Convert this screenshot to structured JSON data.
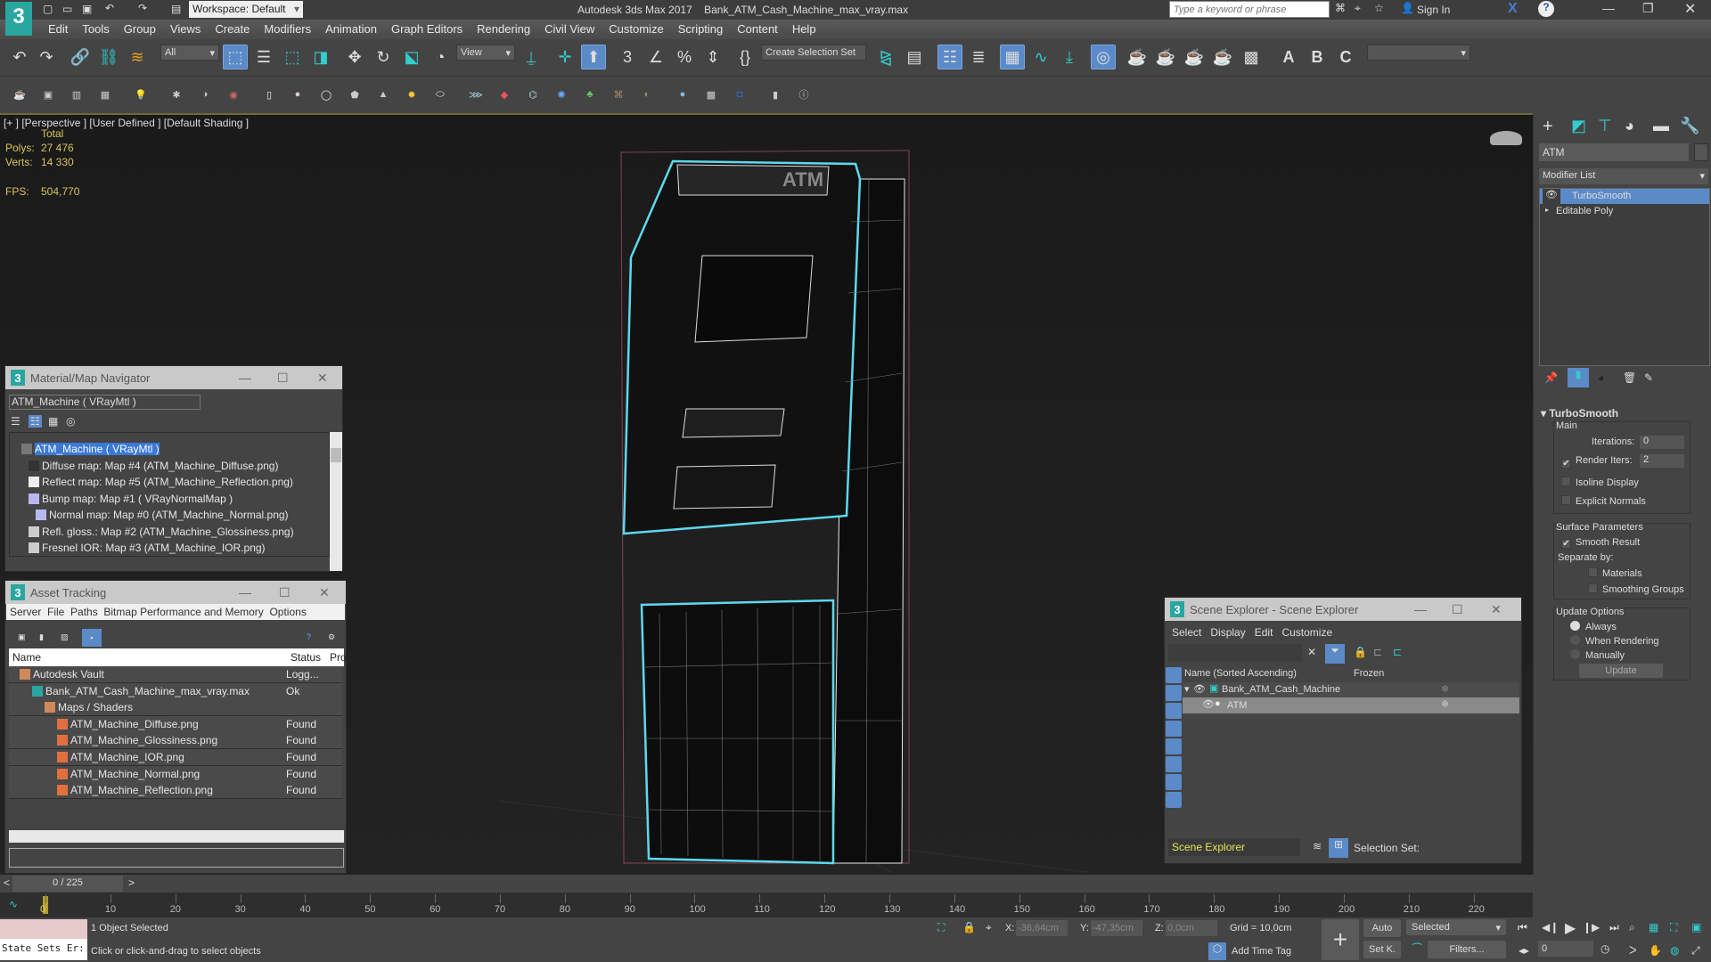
{
  "app": {
    "title": "Autodesk 3ds Max 2017",
    "file": "Bank_ATM_Cash_Machine_max_vray.max",
    "workspace": "Workspace: Default",
    "search_placeholder": "Type a keyword or phrase",
    "sign_in": "Sign In"
  },
  "menu": [
    "Edit",
    "Tools",
    "Group",
    "Views",
    "Create",
    "Modifiers",
    "Animation",
    "Graph Editors",
    "Rendering",
    "Civil View",
    "Customize",
    "Scripting",
    "Content",
    "Help"
  ],
  "toolbar": {
    "selection_filter": "All",
    "ref_coord": "View",
    "create_selection_set": "Create Selection Set"
  },
  "viewport": {
    "label": "[+ ]  [Perspective ]  [User Defined ]  [Default Shading ]",
    "stats_header": "Total",
    "polys_label": "Polys:",
    "polys": "27 476",
    "verts_label": "Verts:",
    "verts": "14 330",
    "fps_label": "FPS:",
    "fps": "504,770",
    "model_sign": "ATM"
  },
  "command_panel": {
    "object_name": "ATM",
    "modifier_list": "Modifier List",
    "stack": [
      {
        "label": "TurboSmooth",
        "selected": true
      },
      {
        "label": "Editable Poly",
        "selected": false
      }
    ],
    "rollout_title": "TurboSmooth",
    "main_group": "Main",
    "iterations_label": "Iterations:",
    "iterations": "0",
    "render_iters_label": "Render Iters:",
    "render_iters": "2",
    "isoline": "Isoline Display",
    "explicit_normals": "Explicit Normals",
    "surface_group": "Surface Parameters",
    "smooth_result": "Smooth Result",
    "separate_by": "Separate by:",
    "materials": "Materials",
    "smoothing_groups": "Smoothing Groups",
    "update_group": "Update Options",
    "always": "Always",
    "when_rendering": "When Rendering",
    "manually": "Manually",
    "update_btn": "Update"
  },
  "mat_nav": {
    "title": "Material/Map Navigator",
    "field": "ATM_Machine  ( VRayMtl )",
    "items": [
      "ATM_Machine  ( VRayMtl )",
      "Diffuse map: Map #4 (ATM_Machine_Diffuse.png)",
      "Reflect map: Map #5 (ATM_Machine_Reflection.png)",
      "Bump map: Map #1  ( VRayNormalMap )",
      "Normal map: Map #0 (ATM_Machine_Normal.png)",
      "Refl. gloss.: Map #2 (ATM_Machine_Glossiness.png)",
      "Fresnel IOR: Map #3 (ATM_Machine_IOR.png)"
    ]
  },
  "asset_tracking": {
    "title": "Asset Tracking",
    "menu": [
      "Server",
      "File",
      "Paths",
      "Bitmap Performance and Memory",
      "Options"
    ],
    "col_name": "Name",
    "col_status": "Status",
    "col_proxy": "Pro:",
    "rows": [
      {
        "name": "Autodesk Vault",
        "status": "Logg...",
        "indent": 0
      },
      {
        "name": "Bank_ATM_Cash_Machine_max_vray.max",
        "status": "Ok",
        "indent": 1
      },
      {
        "name": "Maps / Shaders",
        "status": "",
        "indent": 2
      },
      {
        "name": "ATM_Machine_Diffuse.png",
        "status": "Found",
        "indent": 3
      },
      {
        "name": "ATM_Machine_Glossiness.png",
        "status": "Found",
        "indent": 3
      },
      {
        "name": "ATM_Machine_IOR.png",
        "status": "Found",
        "indent": 3
      },
      {
        "name": "ATM_Machine_Normal.png",
        "status": "Found",
        "indent": 3
      },
      {
        "name": "ATM_Machine_Reflection.png",
        "status": "Found",
        "indent": 3
      }
    ]
  },
  "scene_explorer": {
    "title": "Scene Explorer - Scene Explorer",
    "menu": [
      "Select",
      "Display",
      "Edit",
      "Customize"
    ],
    "col_name": "Name (Sorted Ascending)",
    "col_frozen": "Frozen",
    "rows": [
      "Bank_ATM_Cash_Machine",
      "ATM"
    ],
    "footer_dropdown": "Scene Explorer",
    "selection_set": "Selection Set:"
  },
  "timeline": {
    "frame": "0 / 225",
    "ticks": [
      "0",
      "10",
      "20",
      "30",
      "40",
      "50",
      "60",
      "70",
      "80",
      "90",
      "100",
      "110",
      "120",
      "130",
      "140",
      "150",
      "160",
      "170",
      "180",
      "190",
      "200",
      "210",
      "220"
    ]
  },
  "status": {
    "maxscript": "State Sets Er:",
    "selected": "1 Object Selected",
    "prompt": "Click or click-and-drag to select objects",
    "x_label": "X:",
    "x": "-36,64cm",
    "y_label": "Y:",
    "y": "-47,35cm",
    "z_label": "Z:",
    "z": "0,0cm",
    "grid": "Grid = 10,0cm",
    "add_time_tag": "Add Time Tag",
    "auto": "Auto",
    "set_key": "Set K.",
    "key_filter": "Selected",
    "filters": "Filters...",
    "current_frame": "0"
  }
}
